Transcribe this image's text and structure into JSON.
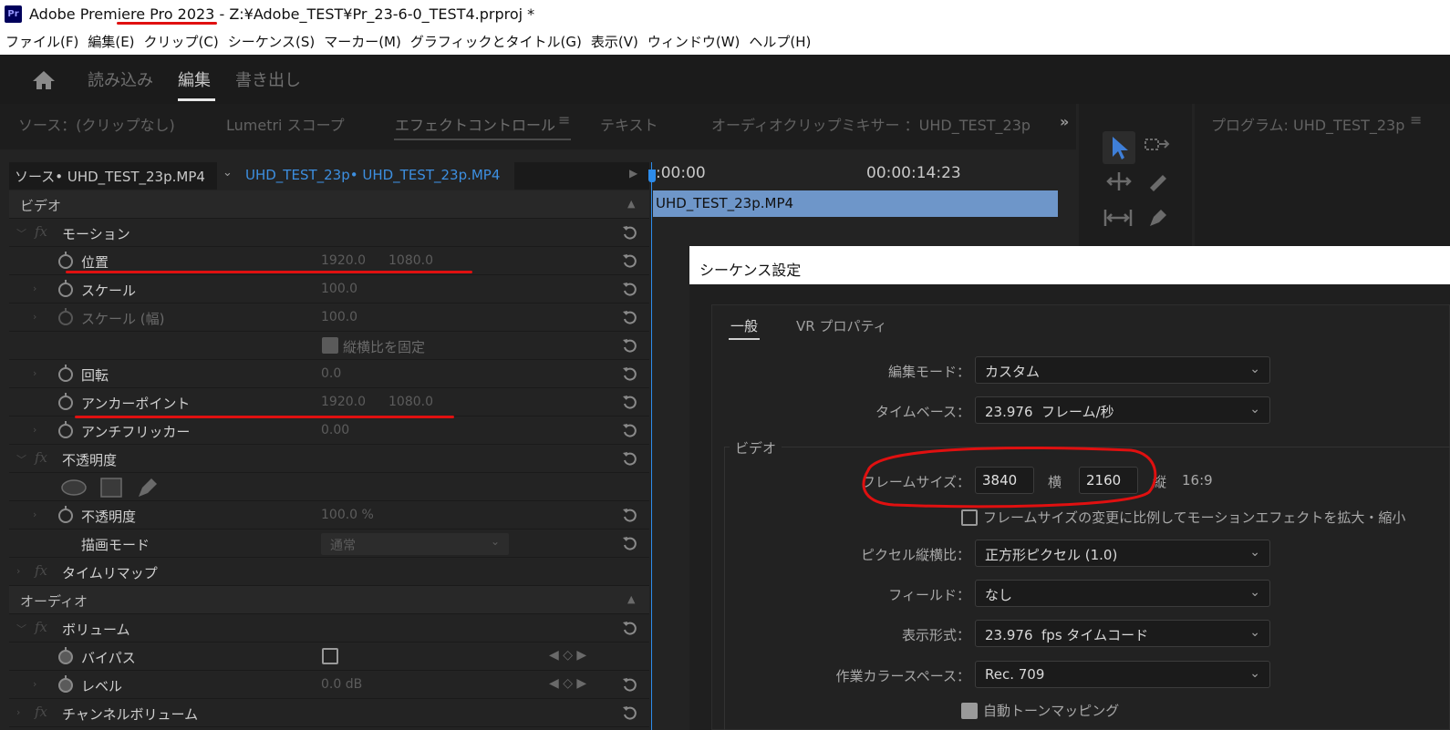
{
  "window": {
    "app_icon": "Pr",
    "title_app": "Adobe Premiere Pro 2023",
    "title_sep": " - ",
    "title_path": "Z:¥Adobe_TEST¥Pr_23-6-0_TEST4.prproj *"
  },
  "menu": [
    "ファイル(F)",
    "編集(E)",
    "クリップ(C)",
    "シーケンス(S)",
    "マーカー(M)",
    "グラフィックとタイトル(G)",
    "表示(V)",
    "ウィンドウ(W)",
    "ヘルプ(H)"
  ],
  "workspace": {
    "tabs": [
      "読み込み",
      "編集",
      "書き出し"
    ],
    "active": "編集"
  },
  "panel_tabs": [
    "ソース：(クリップなし)",
    "Lumetri スコープ",
    "エフェクトコントロール",
    "テキスト",
    "オーディオクリップミキサー ：UHD_TEST_23p",
    "»"
  ],
  "program_tab": "プログラム: UHD_TEST_23p",
  "effect_controls": {
    "source_tab": "ソース• UHD_TEST_23p.MP4",
    "seq_tab": "UHD_TEST_23p• UHD_TEST_23p.MP4",
    "video_header": "ビデオ",
    "audio_header": "オーディオ",
    "rows": [
      {
        "label": "モーション",
        "fx": true
      },
      {
        "label": "位置",
        "v1": "1920.0",
        "v2": "1080.0"
      },
      {
        "label": "スケール",
        "v1": "100.0"
      },
      {
        "label": "スケール (幅)",
        "v1": "100.0",
        "dim": true
      },
      {
        "label": "縦横比を固定",
        "check": true
      },
      {
        "label": "回転",
        "v1": "0.0"
      },
      {
        "label": "アンカーポイント",
        "v1": "1920.0",
        "v2": "1080.0"
      },
      {
        "label": "アンチフリッカー",
        "v1": "0.00"
      },
      {
        "label": "不透明度",
        "fx": true
      },
      {
        "label": "不透明度",
        "v1": "100.0 %"
      },
      {
        "label": "描画モード",
        "v1": "通常"
      },
      {
        "label": "タイムリマップ",
        "fx": true
      },
      {
        "label": "ボリューム",
        "fx": true
      },
      {
        "label": "バイパス"
      },
      {
        "label": "レベル",
        "v1": "0.0 dB"
      },
      {
        "label": "チャンネルボリューム",
        "fx": true
      }
    ]
  },
  "timeline": {
    "t0": ":00:00",
    "t1": "00:00:14:23",
    "clip": "UHD_TEST_23p.MP4"
  },
  "dialog": {
    "title": "シーケンス設定",
    "tabs": [
      "一般",
      "VR プロパティ"
    ],
    "edit_mode_label": "編集モード：",
    "edit_mode": "カスタム",
    "timebase_label": "タイムベース：",
    "timebase": "23.976  フレーム/秒",
    "video_group": "ビデオ",
    "frame_size_label": "フレームサイズ：",
    "frame_w": "3840",
    "w_label": "横",
    "frame_h": "2160",
    "h_label": "縦",
    "aspect": "16:9",
    "scale_motion": "フレームサイズの変更に比例してモーションエフェクトを拡大・縮小",
    "pixel_aspect_label": "ピクセル縦横比：",
    "pixel_aspect": "正方形ピクセル (1.0)",
    "fields_label": "フィールド：",
    "fields": "なし",
    "display_format_label": "表示形式：",
    "display_format": "23.976  fps タイムコード",
    "color_space_label": "作業カラースペース：",
    "color_space": "Rec. 709",
    "auto_tone": "自動トーンマッピング"
  }
}
